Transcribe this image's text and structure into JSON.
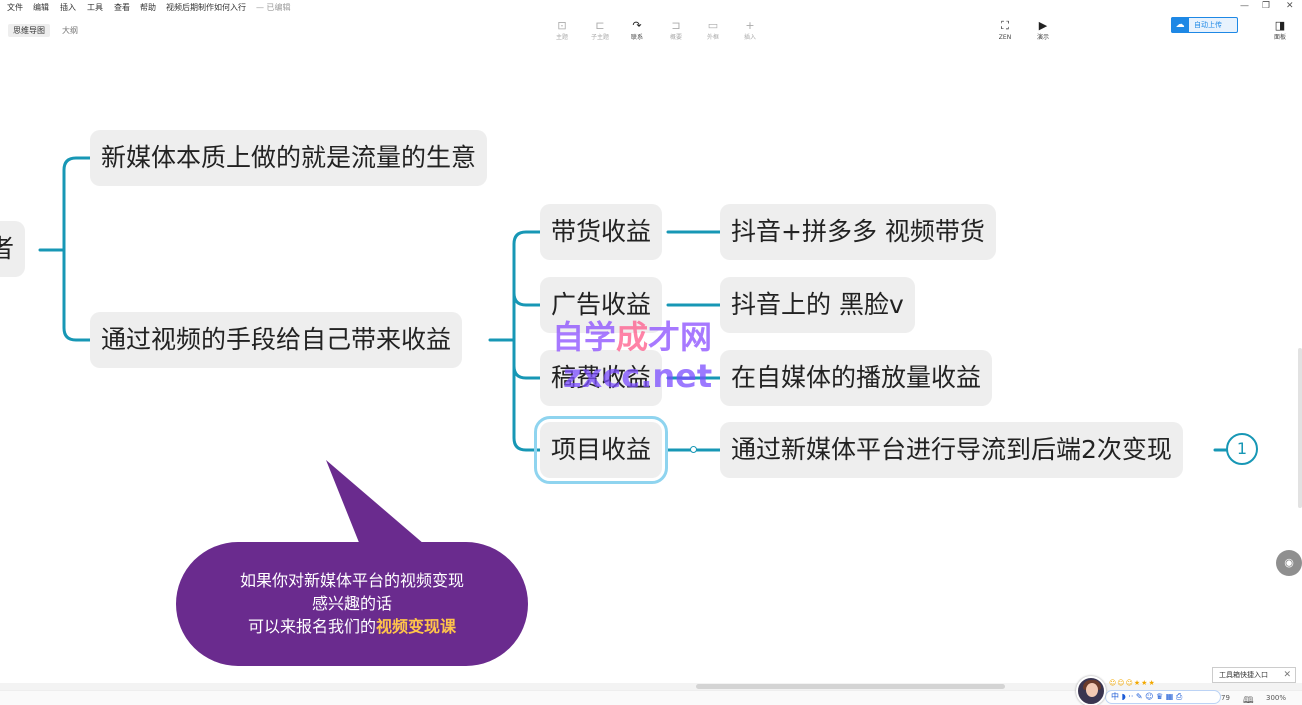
{
  "menu": {
    "items": [
      "文件",
      "编辑",
      "插入",
      "工具",
      "查看",
      "帮助"
    ],
    "doc_title": "视频后期制作如何入行",
    "save_status": "— 已编辑"
  },
  "view_tabs": [
    {
      "label": "思维导图",
      "active": true
    },
    {
      "label": "大纲",
      "active": false
    }
  ],
  "tools": [
    {
      "label": "主题",
      "icon": "topic-icon",
      "glyph": "⊡",
      "enabled": false
    },
    {
      "label": "子主题",
      "icon": "subtopic-icon",
      "glyph": "⊏",
      "enabled": false
    },
    {
      "label": "联系",
      "icon": "relationship-icon",
      "glyph": "↷",
      "enabled": true
    },
    {
      "label": "概要",
      "icon": "summary-icon",
      "glyph": "⊐",
      "enabled": false
    },
    {
      "label": "外框",
      "icon": "boundary-icon",
      "glyph": "▭",
      "enabled": false
    },
    {
      "label": "插入",
      "icon": "insert-icon",
      "glyph": "+",
      "enabled": false
    }
  ],
  "right_tools": [
    {
      "label": "ZEN",
      "icon": "zen-icon",
      "glyph": "⛶"
    },
    {
      "label": "演示",
      "icon": "present-icon",
      "glyph": "▶"
    }
  ],
  "panel_tool": {
    "label": "面板",
    "icon": "panel-icon",
    "glyph": "◨"
  },
  "upload_button": "自动上传",
  "mindmap": {
    "root_partial": "者",
    "branch1": "新媒体本质上做的就是流量的生意",
    "branch2": "通过视频的手段给自己带来收益",
    "sub": [
      {
        "label": "带货收益",
        "detail": "抖音+拼多多  视频带货"
      },
      {
        "label": "广告收益",
        "detail": "抖音上的    黑脸v"
      },
      {
        "label": "稿费收益",
        "detail": "在自媒体的播放量收益"
      },
      {
        "label": "项目收益",
        "detail": "通过新媒体平台进行导流到后端2次变现"
      }
    ],
    "badge": "1"
  },
  "watermark": {
    "line1_a": "自学",
    "line1_b": "成",
    "line1_c": "才网",
    "line2": "zxcc.net"
  },
  "bubble": {
    "line1": "如果你对新媒体平台的视频变现",
    "line2": "感兴趣的话",
    "line3_prefix": "可以来报名我们的",
    "line3_highlight": "视频变现课"
  },
  "toolbox_tip": "工具箱快捷入口",
  "ime_text": "中 ◗ ·· ✎ ☺ ♛ ▦ ⎙",
  "stars": "☺☺☺★★★",
  "status": {
    "count": "79",
    "zoom": "300%"
  },
  "colors": {
    "line": "#1797b5",
    "bubble": "#6a2b8e",
    "highlight": "#ffc44a",
    "selection": "#8fd4ef"
  }
}
